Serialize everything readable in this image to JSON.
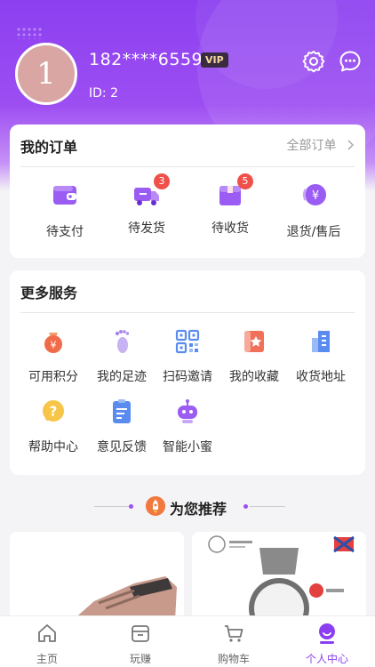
{
  "profile": {
    "avatar_letter": "1",
    "phone": "182****6559",
    "vip": "VIP",
    "id_text": "ID: 2"
  },
  "orders": {
    "title": "我的订单",
    "all_label": "全部订单",
    "items": [
      {
        "label": "待支付",
        "icon": "wallet-icon",
        "badge": null
      },
      {
        "label": "待发货",
        "icon": "truck-icon",
        "badge": "3"
      },
      {
        "label": "待收货",
        "icon": "box-icon",
        "badge": "5"
      },
      {
        "label": "退货/售后",
        "icon": "refund-icon",
        "badge": null
      }
    ]
  },
  "services": {
    "title": "更多服务",
    "items": [
      {
        "label": "可用积分",
        "icon": "points-bag-icon"
      },
      {
        "label": "我的足迹",
        "icon": "footprint-icon"
      },
      {
        "label": "扫码邀请",
        "icon": "qr-code-icon"
      },
      {
        "label": "我的收藏",
        "icon": "favorite-star-icon"
      },
      {
        "label": "收货地址",
        "icon": "address-building-icon"
      },
      {
        "label": "帮助中心",
        "icon": "help-question-icon"
      },
      {
        "label": "意见反馈",
        "icon": "feedback-clipboard-icon"
      },
      {
        "label": "智能小蜜",
        "icon": "robot-icon"
      }
    ]
  },
  "recommend": {
    "title": "为您推荐"
  },
  "tabbar": {
    "items": [
      {
        "label": "主页",
        "icon": "home-icon"
      },
      {
        "label": "玩赚",
        "icon": "gift-box-icon"
      },
      {
        "label": "购物车",
        "icon": "cart-icon"
      },
      {
        "label": "个人中心",
        "icon": "user-icon"
      }
    ],
    "active_index": 3
  },
  "colors": {
    "brand": "#8b3ff0",
    "badge": "#f0504a"
  }
}
